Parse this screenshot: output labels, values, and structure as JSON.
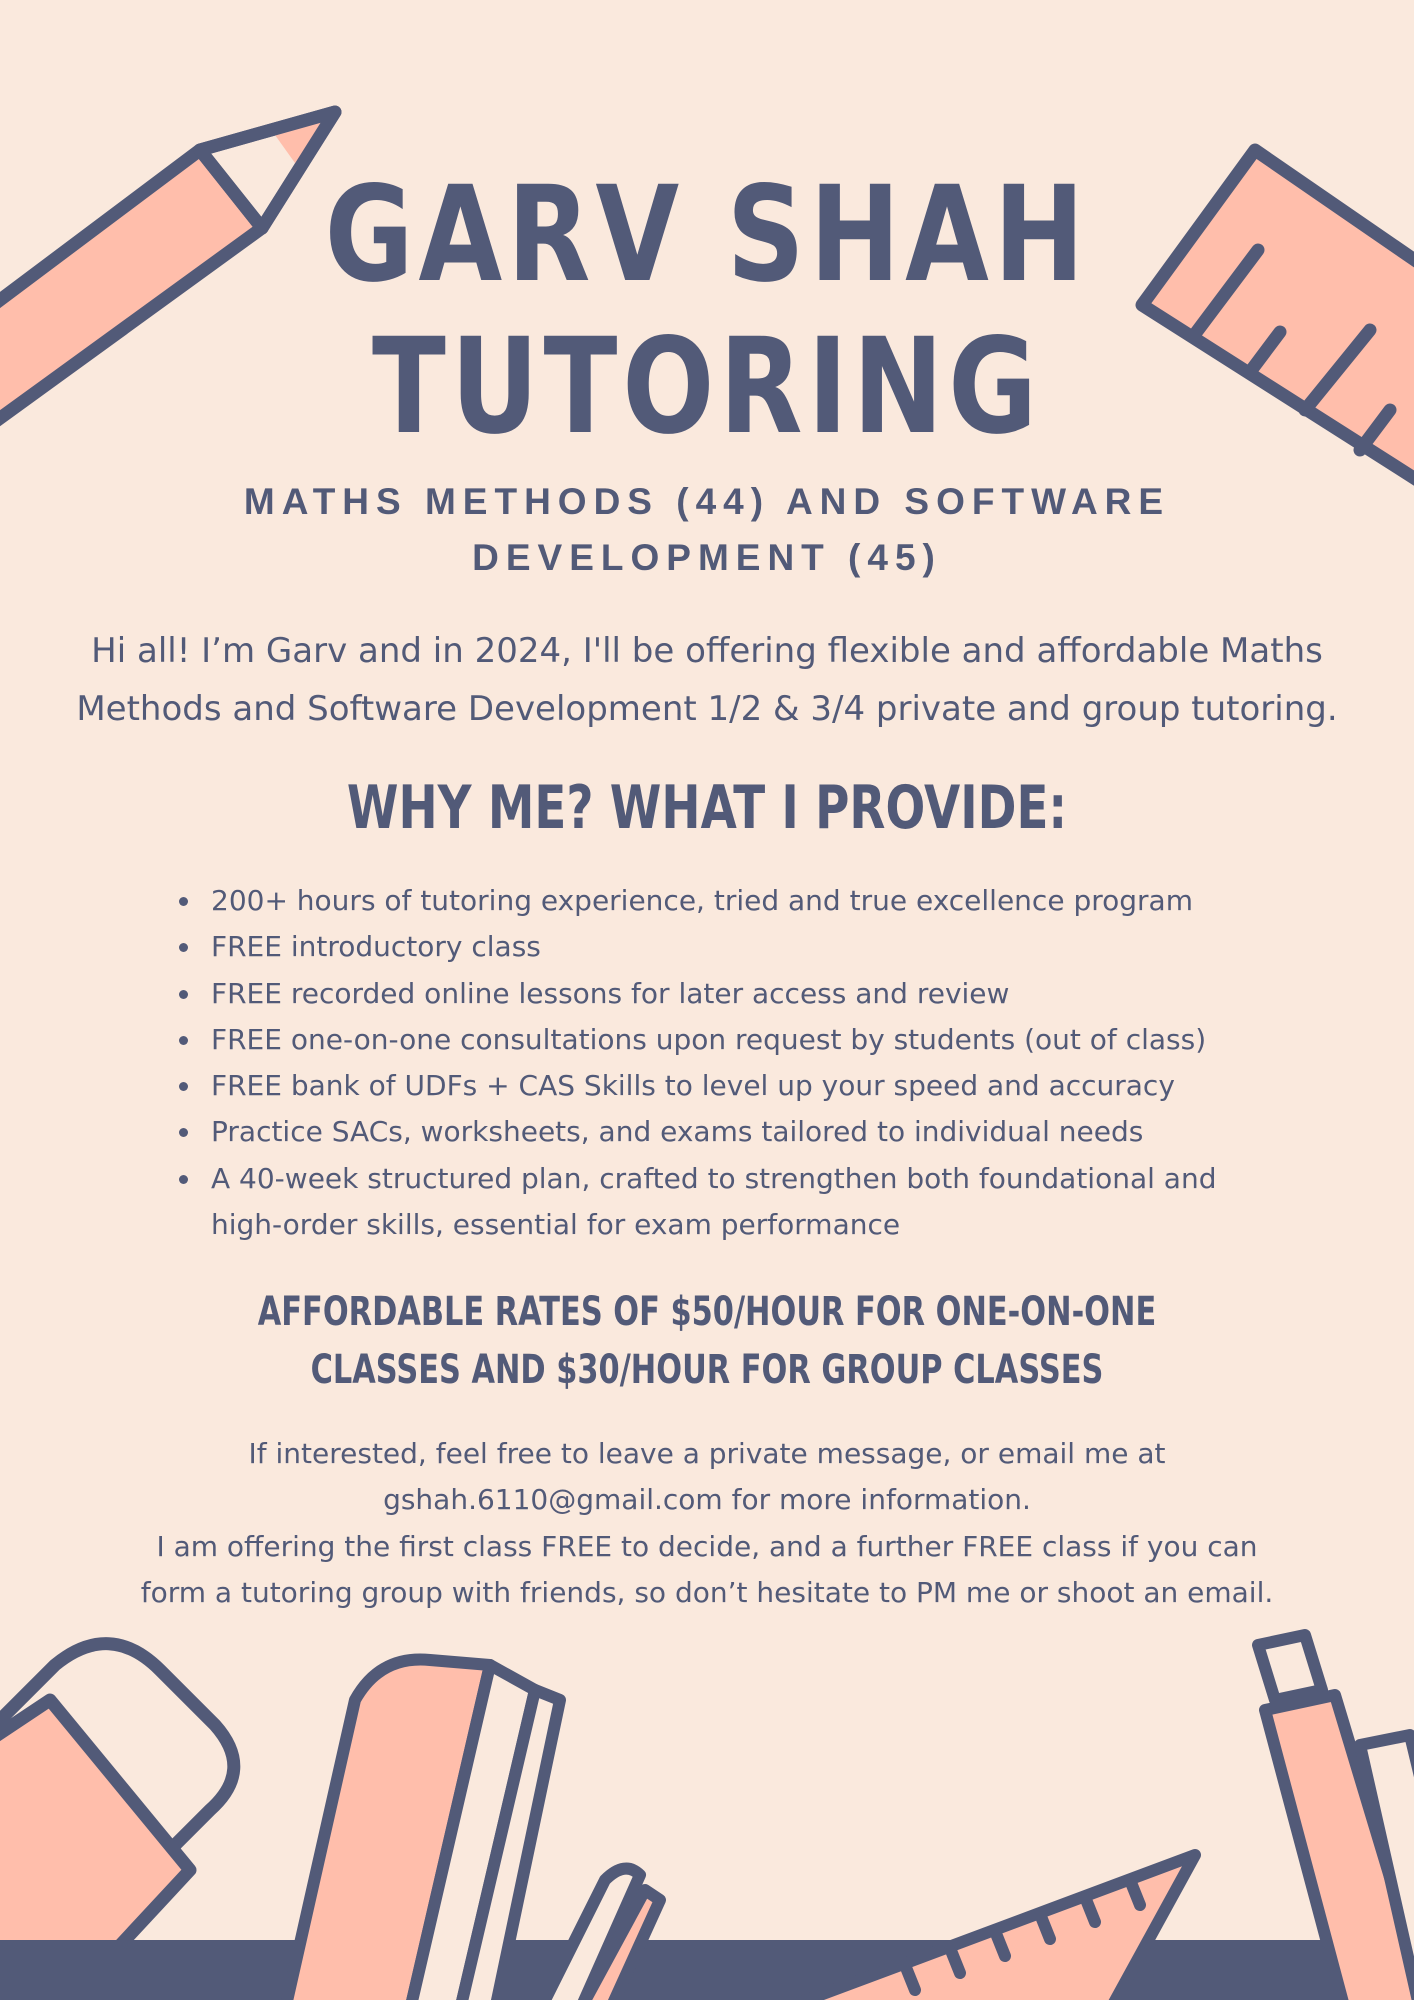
{
  "colors": {
    "background": "#fae9dd",
    "ink": "#525a78",
    "accent": "#ffbeab"
  },
  "header": {
    "title_line1": "GARV SHAH",
    "title_line2": "TUTORING",
    "subtitle_line1": "MATHS METHODS (44) AND SOFTWARE",
    "subtitle_line2": "DEVELOPMENT (45)"
  },
  "intro": {
    "line1": "Hi all! I’m Garv and in 2024, I'll be offering flexible and affordable Maths",
    "line2": "Methods and Software Development 1/2 & 3/4 private and group tutoring."
  },
  "provide": {
    "heading": "WHY ME? WHAT I PROVIDE:",
    "items": [
      "200+ hours of tutoring experience, tried and true excellence program",
      "FREE introductory class",
      "FREE recorded online lessons for later access and review",
      "FREE one-on-one consultations upon request by students (out of class)",
      "FREE bank of UDFs + CAS Skills to level up your speed and accuracy",
      "Practice SACs, worksheets, and exams tailored to individual needs",
      "A 40-week structured plan, crafted to strengthen both foundational and high-order skills, essential for exam performance"
    ]
  },
  "rates": {
    "line1": "AFFORDABLE RATES OF $50/HOUR FOR ONE-ON-ONE",
    "line2": "CLASSES AND $30/HOUR FOR GROUP CLASSES"
  },
  "contact": {
    "line1": "If interested, feel free to leave a private message, or email me at",
    "line2": "gshah.6110@gmail.com for more information.",
    "line3": "I am offering the first class FREE to decide, and a further FREE class if you can",
    "line4": "form a tutoring group with friends, so don’t hesitate to PM me or shoot an email."
  },
  "decorations": [
    "pencil-illustration",
    "ruler-illustration",
    "eraser-illustration",
    "stationery-pile-illustration",
    "triangle-ruler-illustration",
    "pen-illustration"
  ]
}
